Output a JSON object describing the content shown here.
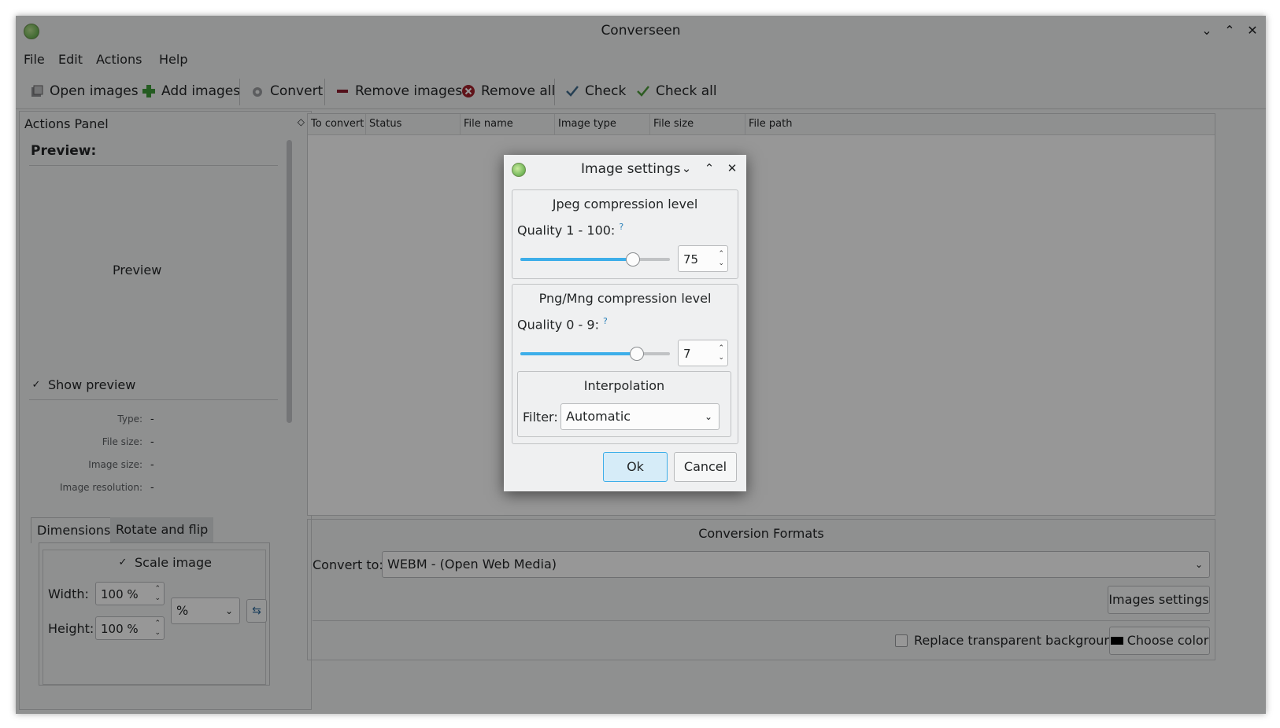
{
  "window": {
    "title": "Converseen"
  },
  "menu": [
    "File",
    "Edit",
    "Actions",
    "Help"
  ],
  "toolbar": {
    "open_images": "Open images",
    "add_images": "Add images",
    "convert": "Convert",
    "remove_images": "Remove images",
    "remove_all": "Remove all",
    "check": "Check",
    "check_all": "Check all"
  },
  "actions_panel": {
    "title": "Actions Panel",
    "preview_heading": "Preview:",
    "preview_placeholder": "Preview",
    "show_preview": "Show preview",
    "info": [
      {
        "label": "Type:",
        "value": "-"
      },
      {
        "label": "File size:",
        "value": "-"
      },
      {
        "label": "Image size:",
        "value": "-"
      },
      {
        "label": "Image resolution:",
        "value": "-"
      }
    ],
    "tabs": [
      "Dimensions",
      "Rotate and flip"
    ],
    "scale_image": "Scale image",
    "width_label": "Width:",
    "width_value": "100 %",
    "height_label": "Height:",
    "height_value": "100 %",
    "unit": "%"
  },
  "file_table": {
    "columns": [
      "To convert",
      "Status",
      "File name",
      "Image type",
      "File size",
      "File path"
    ]
  },
  "conversion": {
    "title": "Conversion Formats",
    "convert_to_label": "Convert to:",
    "format": "WEBM - (Open Web Media)",
    "images_settings": "Images settings",
    "replace_bg": "Replace transparent background",
    "choose_color": "Choose color"
  },
  "dialog": {
    "title": "Image settings",
    "jpeg": {
      "title": "Jpeg compression level",
      "quality_label": "Quality 1 - 100:",
      "help": "?",
      "value": "75",
      "level": 0.75
    },
    "png": {
      "title": "Png/Mng compression level",
      "quality_label": "Quality 0 - 9:",
      "help": "?",
      "value": "7",
      "level": 0.78
    },
    "interpolation": {
      "title": "Interpolation",
      "filter_label": "Filter:",
      "filter_value": "Automatic"
    },
    "ok": "Ok",
    "cancel": "Cancel"
  },
  "colors": {
    "accent": "#3daee9",
    "window_bg": "#eff0f1"
  }
}
